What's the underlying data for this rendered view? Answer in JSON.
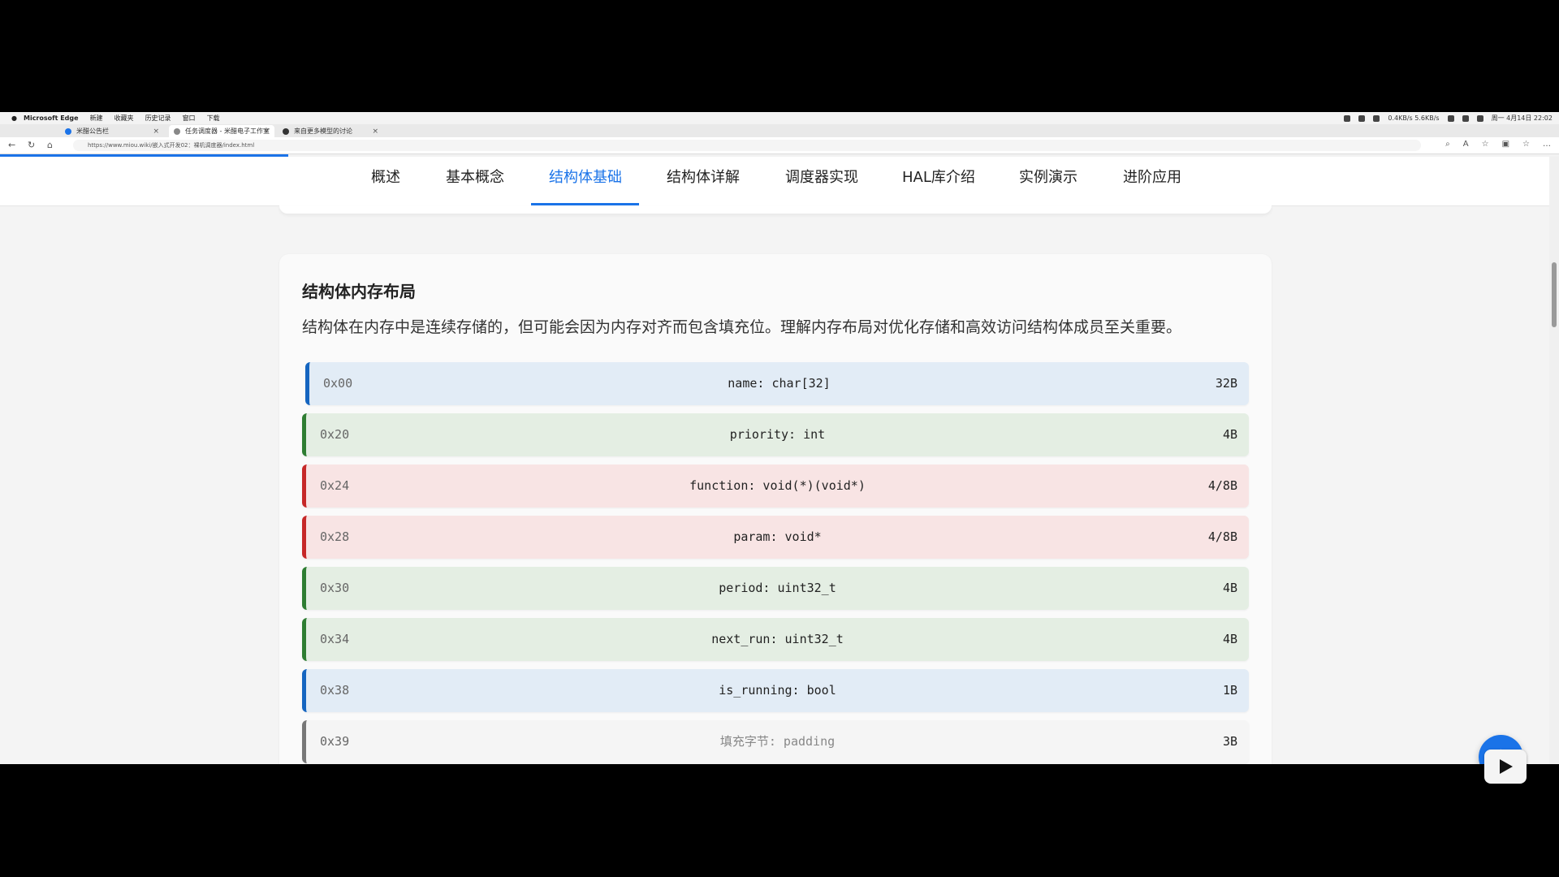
{
  "os_menu": {
    "app": "Microsoft Edge",
    "items": [
      "新建",
      "收藏夹",
      "历史记录",
      "窗口",
      "下载"
    ],
    "clock": "周一 4月14日 22:02",
    "net_speed": "0.4KB/s 5.6KB/s"
  },
  "tabs": [
    {
      "title": "米醋公告栏"
    },
    {
      "title": "任务调度器 - 米醋电子工作室"
    },
    {
      "title": "来自更多模型的讨论"
    }
  ],
  "address": {
    "url": "https://www.miou.wiki/嵌入式开发02：裸机调度器/index.html"
  },
  "nav": {
    "items": [
      "概述",
      "基本概念",
      "结构体基础",
      "结构体详解",
      "调度器实现",
      "HAL库介绍",
      "实例演示",
      "进阶应用"
    ],
    "active": "结构体基础"
  },
  "section": {
    "title": "结构体内存布局",
    "description": "结构体在内存中是连续存储的，但可能会因为内存对齐而包含填充位。理解内存布局对优化存储和高效访问结构体成员至关重要。",
    "rows": [
      {
        "addr": "0x00",
        "field": "name: char[32]",
        "size": "32B",
        "type": "blue"
      },
      {
        "addr": "0x20",
        "field": "priority: int",
        "size": "4B",
        "type": "green"
      },
      {
        "addr": "0x24",
        "field": "function: void(*)(void*)",
        "size": "4/8B",
        "type": "red"
      },
      {
        "addr": "0x28",
        "field": "param: void*",
        "size": "4/8B",
        "type": "red"
      },
      {
        "addr": "0x30",
        "field": "period: uint32_t",
        "size": "4B",
        "type": "green"
      },
      {
        "addr": "0x34",
        "field": "next_run: uint32_t",
        "size": "4B",
        "type": "green"
      },
      {
        "addr": "0x38",
        "field": "is_running: bool",
        "size": "1B",
        "type": "blue"
      },
      {
        "addr": "0x39",
        "field": "填充字节: padding",
        "size": "3B",
        "type": "gray"
      }
    ]
  },
  "scroll_top_label": "↑",
  "colors": {
    "accent": "#1a73e8",
    "blue_row": "#e2ecf6",
    "green_row": "#e4eee3",
    "red_row": "#f8e4e4"
  }
}
